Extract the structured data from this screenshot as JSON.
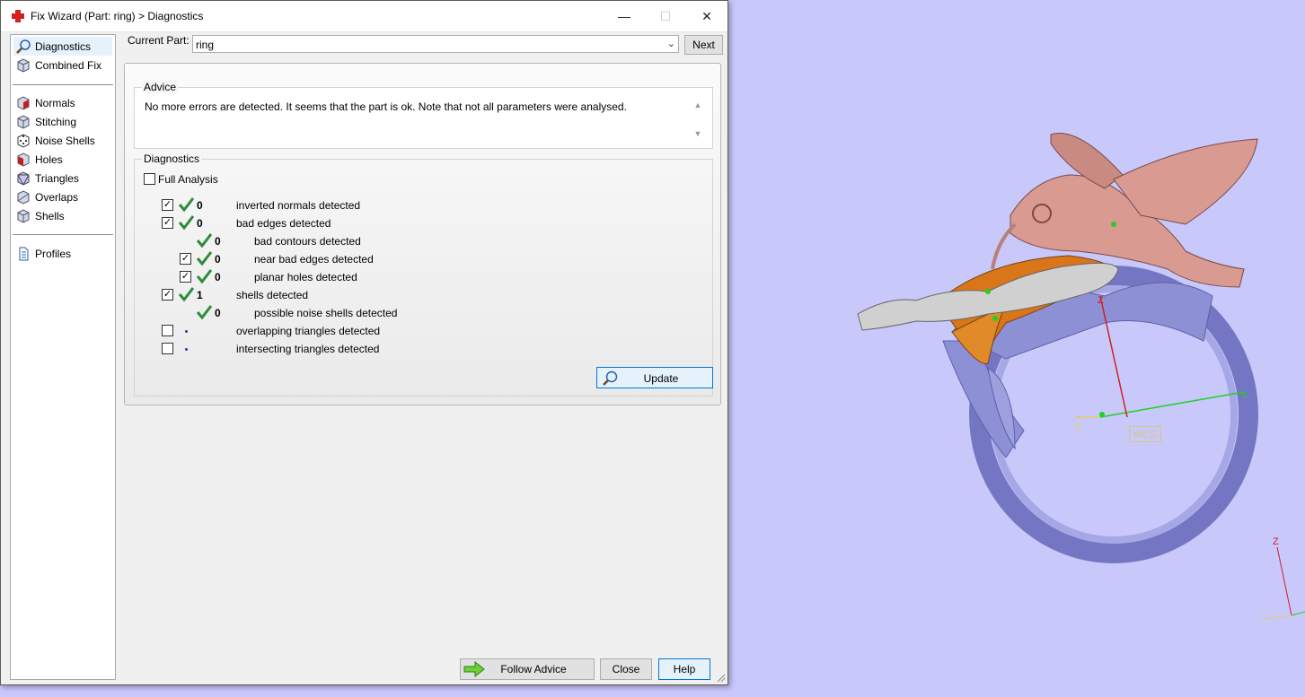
{
  "window": {
    "title": "Fix Wizard (Part: ring) > Diagnostics",
    "min_glyph": "—",
    "max_glyph": "☐",
    "close_glyph": "✕",
    "icon": "red-cross-icon"
  },
  "sidebar": {
    "items": [
      {
        "label": "Diagnostics",
        "icon": "magnifier-icon",
        "selected": true
      },
      {
        "label": "Combined Fix",
        "icon": "cube-icon"
      },
      {
        "label": "Normals",
        "icon": "normals-cube-icon"
      },
      {
        "label": "Stitching",
        "icon": "stitching-cube-icon"
      },
      {
        "label": "Noise Shells",
        "icon": "dice-icon"
      },
      {
        "label": "Holes",
        "icon": "holes-cube-icon"
      },
      {
        "label": "Triangles",
        "icon": "triangles-cube-icon"
      },
      {
        "label": "Overlaps",
        "icon": "overlaps-cube-icon"
      },
      {
        "label": "Shells",
        "icon": "shells-cube-icon"
      },
      {
        "label": "Profiles",
        "icon": "document-icon"
      }
    ]
  },
  "current_part": {
    "label": "Current Part:",
    "value": "ring",
    "next_label": "Next"
  },
  "advice": {
    "title": "Advice",
    "text": "No more errors are detected. It seems that the part is ok. Note that not all parameters were analysed.",
    "scroll_up": "▲",
    "scroll_down": "▼"
  },
  "diagnostics": {
    "title": "Diagnostics",
    "full_analysis_label": "Full Analysis",
    "full_analysis_checked": false,
    "rows": [
      {
        "checkbox": true,
        "checked": true,
        "status": "ok",
        "count": "0",
        "label": "inverted normals detected",
        "indent": 0
      },
      {
        "checkbox": true,
        "checked": true,
        "status": "ok",
        "count": "0",
        "label": "bad edges detected",
        "indent": 0
      },
      {
        "checkbox": false,
        "checked": false,
        "status": "ok",
        "count": "0",
        "label": "bad contours detected",
        "indent": 1
      },
      {
        "checkbox": true,
        "checked": true,
        "status": "ok",
        "count": "0",
        "label": "near bad edges detected",
        "indent": 1
      },
      {
        "checkbox": true,
        "checked": true,
        "status": "ok",
        "count": "0",
        "label": "planar holes detected",
        "indent": 1
      },
      {
        "checkbox": true,
        "checked": true,
        "status": "ok",
        "count": "1",
        "label": "shells detected",
        "indent": 0
      },
      {
        "checkbox": false,
        "checked": false,
        "status": "ok",
        "count": "0",
        "label": "possible noise shells detected",
        "indent": 1
      },
      {
        "checkbox": true,
        "checked": false,
        "status": "pending",
        "count": "",
        "label": "overlapping triangles detected",
        "indent": 0
      },
      {
        "checkbox": true,
        "checked": false,
        "status": "pending",
        "count": "",
        "label": "intersecting triangles detected",
        "indent": 0
      }
    ],
    "update_label": "Update",
    "check_mark": "✓"
  },
  "footer": {
    "follow_advice_label": "Follow Advice",
    "close_label": "Close",
    "help_label": "Help"
  },
  "viewport": {
    "background": "#c8c8fb",
    "wcs_label": "WCS",
    "axis_labels": {
      "x": "x",
      "y": "y",
      "z": "Z"
    },
    "colors": {
      "ring_band": "#8e90d6",
      "bird": "#d99a92",
      "flower": "#d9761a",
      "petal_rim": "#d0d0d0",
      "axis_x": "#20d020",
      "axis_y": "#e0d060",
      "axis_z": "#d02020"
    }
  }
}
